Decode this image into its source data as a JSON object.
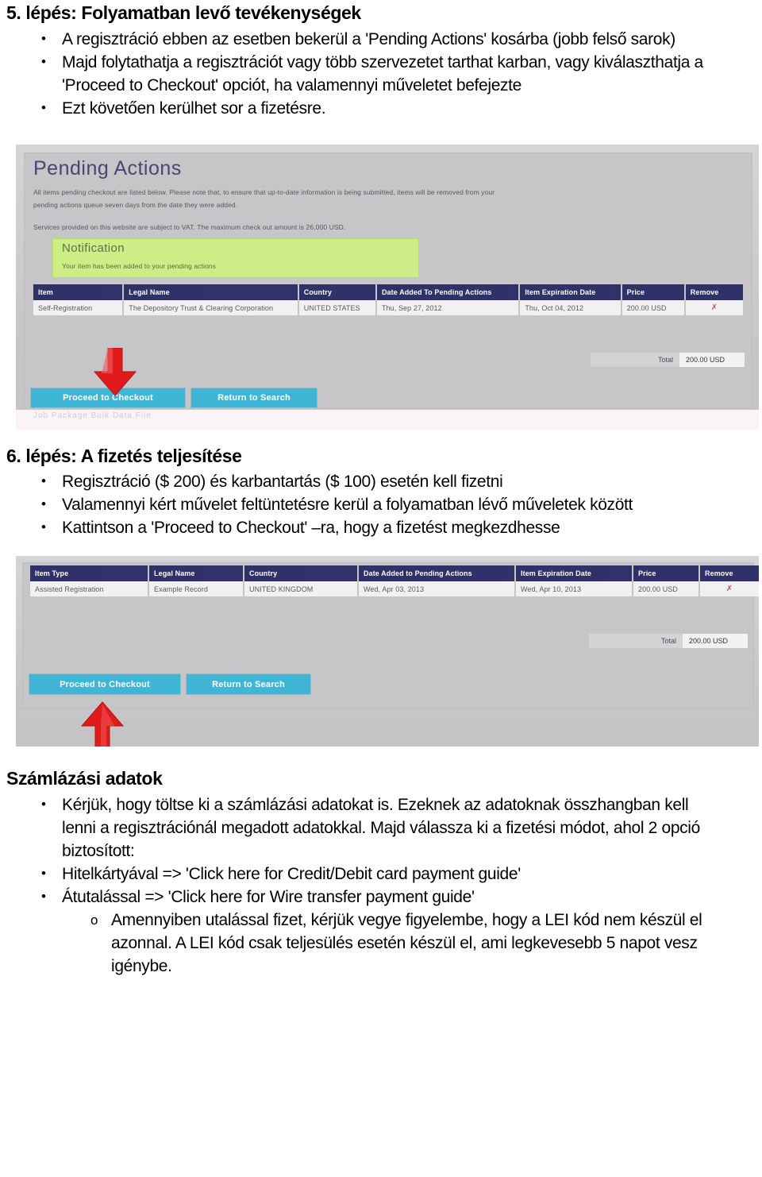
{
  "document": {
    "step5": {
      "heading": "5. lépés: Folyamatban levő tevékenységek",
      "bullets": [
        "A regisztráció ebben az esetben bekerül a 'Pending Actions' kosárba (jobb felső sarok)",
        "Majd folytathatja a regisztrációt vagy több szervezetet tarthat karban, vagy kiválaszthatja a",
        "'Proceed to Checkout' opciót, ha valamennyi műveletet befejezte",
        "Ezt követően kerülhet sor a fizetésre."
      ]
    },
    "step6": {
      "heading": "6. lépés: A fizetés teljesítése",
      "bullets": [
        "Regisztráció ($ 200) és karbantartás ($ 100) esetén kell fizetni",
        "Valamennyi kért művelet feltüntetésre kerül a folyamatban lévő műveletek között",
        "Kattintson a 'Proceed to Checkout' –ra, hogy a fizetést megkezdhesse"
      ]
    },
    "billing": {
      "heading": "Számlázási adatok",
      "bullets": [
        "Kérjük, hogy töltse ki a számlázási adatokat is. Ezeknek az adatoknak összhangban kell",
        "lenni a regisztrációnál megadott adatokkal. Majd válassza ki a fizetési módot, ahol 2 opció",
        "biztosított:",
        "Hitelkártyával => 'Click here for Credit/Debit card payment guide'",
        "Átutalással => 'Click here for Wire transfer payment guide'"
      ],
      "sub_bullets": [
        "Amennyiben utalással fizet, kérjük vegye figyelembe, hogy a LEI kód nem készül el",
        "azonnal. A LEI kód csak teljesülés esetén készül el, ami legkevesebb 5 napot vesz",
        "igénybe."
      ]
    }
  },
  "screenshot1": {
    "title": "Pending Actions",
    "intro_line1": "All items pending checkout are listed below. Please note that, to ensure that up-to-date information is being submitted, items will be removed from your",
    "intro_line2": "pending actions queue seven days from the date they were added.",
    "vat_note": "Services provided on this website are subject to VAT. The maximum check out amount is 26,000 USD.",
    "notification": {
      "title": "Notification",
      "text": "Your item has been added to your pending actions"
    },
    "table": {
      "headers": [
        "Item",
        "Legal Name",
        "Country",
        "Date Added To Pending Actions",
        "Item Expiration Date",
        "Price",
        "Remove"
      ],
      "rows": [
        [
          "Self-Registration",
          "The Depository Trust & Clearing Corporation",
          "UNITED STATES",
          "Thu, Sep 27, 2012",
          "Thu, Oct 04, 2012",
          "200.00 USD",
          "✗"
        ]
      ]
    },
    "total": {
      "label": "Total",
      "value": "200.00 USD"
    },
    "buttons": {
      "checkout": "Proceed to Checkout",
      "return": "Return to Search"
    },
    "ghost_line": "Job Package Bulk Data File"
  },
  "screenshot2": {
    "table": {
      "headers": [
        "Item Type",
        "Legal Name",
        "Country",
        "Date Added to Pending Actions",
        "Item Expiration Date",
        "Price",
        "Remove"
      ],
      "rows": [
        [
          "Assisted Registration",
          "Example Record",
          "UNITED KINGDOM",
          "Wed, Apr 03, 2013",
          "Wed, Apr 10, 2013",
          "200.00 USD",
          "✗"
        ]
      ]
    },
    "total": {
      "label": "Total",
      "value": "200.00 USD"
    },
    "buttons": {
      "checkout": "Proceed to Checkout",
      "return": "Return to Search"
    }
  },
  "colors": {
    "table_header": "#2a2a66",
    "button": "#3fb6d6",
    "notification": "#cdee86",
    "arrow": "#e01b1b",
    "title_text": "#2b2b5e"
  }
}
